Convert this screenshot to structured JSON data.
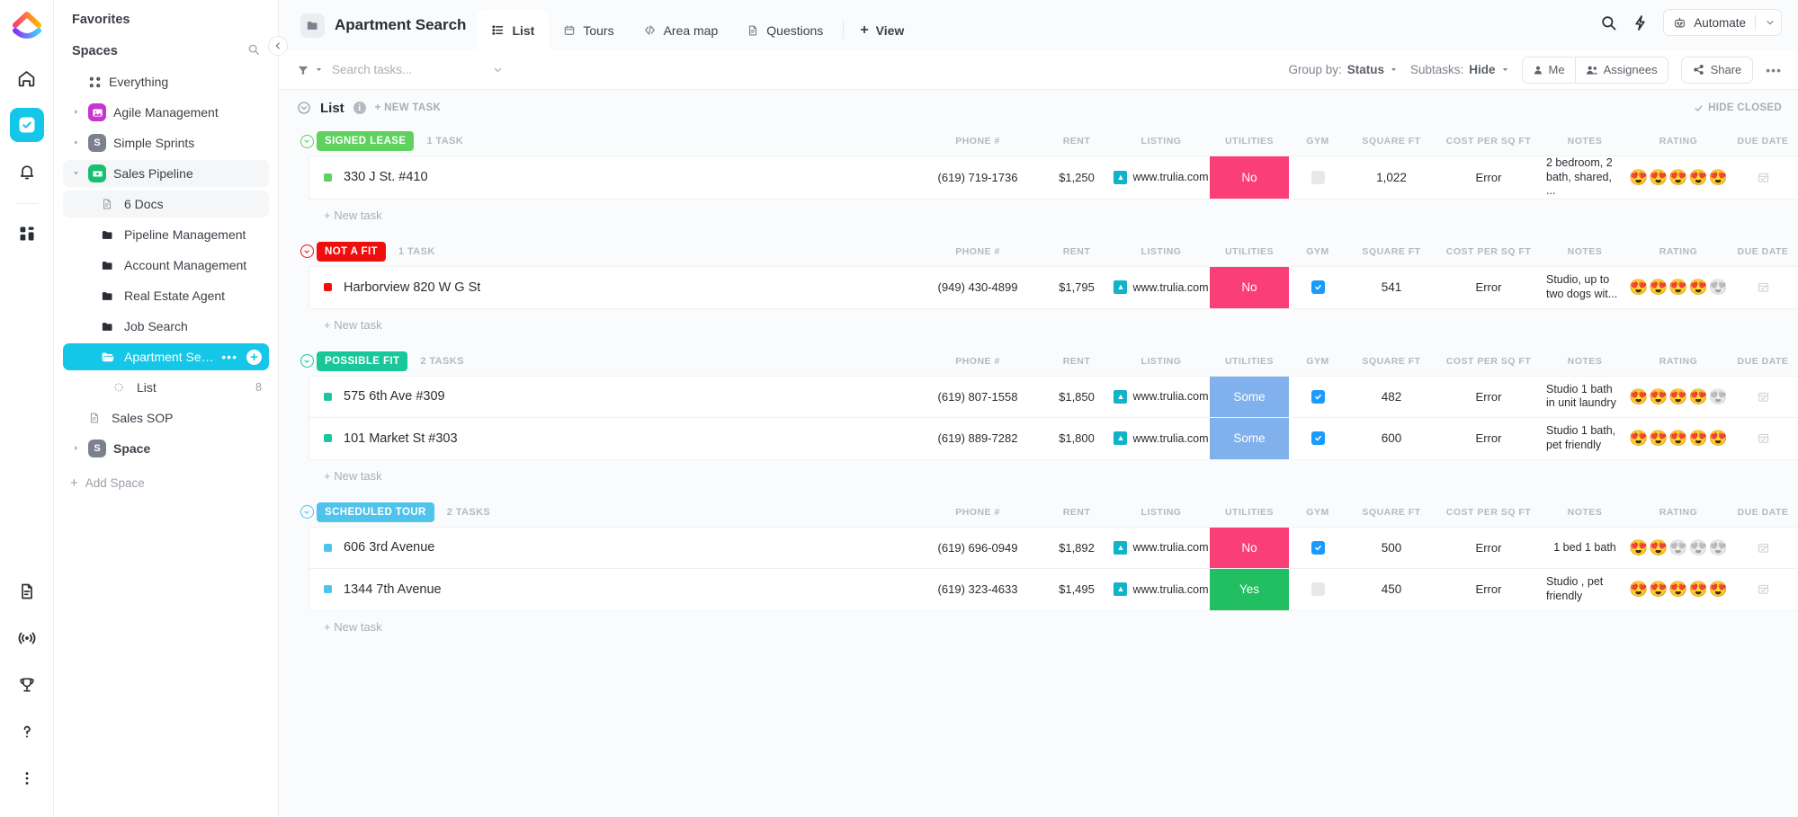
{
  "rail": {
    "logo_icon": "clickup-logo",
    "items": [
      {
        "name": "home-icon",
        "glyph": "home",
        "active": false
      },
      {
        "name": "tasks-icon",
        "glyph": "check",
        "active": true
      },
      {
        "name": "notifications-icon",
        "glyph": "bell",
        "active": false
      },
      {
        "name": "dashboards-icon",
        "glyph": "grid",
        "active": false
      }
    ],
    "bottom_items": [
      {
        "name": "docs-icon",
        "glyph": "doc"
      },
      {
        "name": "pulse-icon",
        "glyph": "pulse"
      },
      {
        "name": "goals-icon",
        "glyph": "trophy"
      },
      {
        "name": "help-icon",
        "glyph": "question"
      },
      {
        "name": "more-icon",
        "glyph": "dots"
      }
    ]
  },
  "sidebar": {
    "favorites_label": "Favorites",
    "spaces_label": "Spaces",
    "spaces_search_icon": "search-icon",
    "everything_label": "Everything",
    "add_space_label": "Add Space",
    "items": [
      {
        "label": "Agile Management",
        "icon_letter": "",
        "icon_color": "#c735d0",
        "icon_glyph": "image",
        "caret": "right",
        "state": "normal",
        "indent": 0
      },
      {
        "label": "Simple Sprints",
        "icon_letter": "S",
        "icon_color": "#7c828d",
        "icon_glyph": "letter",
        "caret": "right",
        "state": "normal",
        "indent": 0
      },
      {
        "label": "Sales Pipeline",
        "icon_letter": "",
        "icon_color": "#18c172",
        "icon_glyph": "money",
        "caret": "down",
        "state": "hover",
        "indent": 0
      },
      {
        "label": "6 Docs",
        "icon_letter": "",
        "icon_color": "",
        "icon_glyph": "doc",
        "caret": "none",
        "state": "hover",
        "indent": 1
      },
      {
        "label": "Pipeline Management",
        "icon_letter": "",
        "icon_color": "",
        "icon_glyph": "folder-solid",
        "caret": "none",
        "state": "normal",
        "indent": 1
      },
      {
        "label": "Account Management",
        "icon_letter": "",
        "icon_color": "",
        "icon_glyph": "folder-solid",
        "caret": "none",
        "state": "normal",
        "indent": 1
      },
      {
        "label": "Real Estate Agent",
        "icon_letter": "",
        "icon_color": "",
        "icon_glyph": "folder-solid",
        "caret": "none",
        "state": "normal",
        "indent": 1
      },
      {
        "label": "Job Search",
        "icon_letter": "",
        "icon_color": "",
        "icon_glyph": "folder-solid",
        "caret": "none",
        "state": "normal",
        "indent": 1
      },
      {
        "label": "Apartment Search",
        "icon_letter": "",
        "icon_color": "",
        "icon_glyph": "folder-open",
        "caret": "none",
        "state": "selected",
        "indent": 1
      },
      {
        "label": "List",
        "icon_letter": "",
        "icon_color": "",
        "icon_glyph": "list-circle",
        "caret": "none",
        "state": "normal",
        "indent": 2,
        "count": "8"
      },
      {
        "label": "Sales SOP",
        "icon_letter": "",
        "icon_color": "",
        "icon_glyph": "doc",
        "caret": "none",
        "state": "normal",
        "indent": 0
      },
      {
        "label": "Space",
        "icon_letter": "S",
        "icon_color": "#7c828d",
        "icon_glyph": "letter",
        "caret": "right",
        "state": "normal",
        "indent": 0
      }
    ],
    "selected_actions": {
      "more_label": "•••",
      "add_label": "+"
    },
    "collapse_icon": "chevron-left-icon"
  },
  "topbar": {
    "folder_icon": "folder-icon",
    "title": "Apartment Search",
    "tabs": [
      {
        "label": "List",
        "icon": "list-icon",
        "active": true
      },
      {
        "label": "Tours",
        "icon": "calendar-icon",
        "active": false
      },
      {
        "label": "Area map",
        "icon": "embed-icon",
        "active": false
      },
      {
        "label": "Questions",
        "icon": "doc-icon",
        "active": false
      }
    ],
    "add_view_label": "View",
    "search_icon": "search-icon",
    "bolt_icon": "bolt-icon",
    "automate_label": "Automate",
    "automate_icon": "robot-icon",
    "automate_caret": "chevron-down-icon"
  },
  "toolbar": {
    "filter_icon": "filter-icon",
    "search_placeholder": "Search tasks...",
    "search_value": "",
    "search_caret_icon": "chevron-down-icon",
    "group_by_label": "Group by:",
    "group_by_value": "Status",
    "subtasks_label": "Subtasks:",
    "subtasks_value": "Hide",
    "me_label": "Me",
    "assignees_label": "Assignees",
    "share_label": "Share",
    "more_label": "•••"
  },
  "list_header": {
    "title": "List",
    "info_icon": "info-icon",
    "new_task_label": "+ NEW TASK",
    "hide_closed_label": "HIDE CLOSED",
    "hide_closed_icon": "check-icon"
  },
  "columns": [
    {
      "key": "phone",
      "label": "PHONE #"
    },
    {
      "key": "rent",
      "label": "RENT"
    },
    {
      "key": "listing",
      "label": "LISTING"
    },
    {
      "key": "utilities",
      "label": "UTILITIES"
    },
    {
      "key": "gym",
      "label": "GYM"
    },
    {
      "key": "sqft",
      "label": "SQUARE FT"
    },
    {
      "key": "cost_sqft",
      "label": "COST PER SQ FT"
    },
    {
      "key": "notes",
      "label": "NOTES"
    },
    {
      "key": "rating",
      "label": "RATING"
    },
    {
      "key": "due",
      "label": "DUE DATE"
    }
  ],
  "new_task_label": "+ New task",
  "groups": [
    {
      "status": "SIGNED LEASE",
      "color": "#5ed15e",
      "task_count": "1 TASK",
      "tasks": [
        {
          "name": "330 J St. #410",
          "dot_color": "#5ed15e",
          "phone": "(619) 719-1736",
          "rent": "$1,250",
          "listing": "www.trulia.com",
          "utilities": "No",
          "utilities_color": "#fa3f77",
          "gym": false,
          "sqft": "1,022",
          "cost_sqft": "Error",
          "notes": "2 bedroom, 2 bath, shared, ...",
          "rating": 5,
          "rating_max": 5
        }
      ]
    },
    {
      "status": "NOT A FIT",
      "color": "#f20d0d",
      "task_count": "1 TASK",
      "tasks": [
        {
          "name": "Harborview 820 W G St",
          "dot_color": "#f20d0d",
          "phone": "(949) 430-4899",
          "rent": "$1,795",
          "listing": "www.trulia.com",
          "utilities": "No",
          "utilities_color": "#fa3f77",
          "gym": true,
          "sqft": "541",
          "cost_sqft": "Error",
          "notes": "Studio, up to two dogs wit...",
          "rating": 4,
          "rating_max": 5
        }
      ]
    },
    {
      "status": "POSSIBLE FIT",
      "color": "#1ac79a",
      "task_count": "2 TASKS",
      "tasks": [
        {
          "name": "575 6th Ave #309",
          "dot_color": "#1ac79a",
          "phone": "(619) 807-1558",
          "rent": "$1,850",
          "listing": "www.trulia.com",
          "utilities": "Some",
          "utilities_color": "#81b1ec",
          "gym": true,
          "sqft": "482",
          "cost_sqft": "Error",
          "notes": "Studio 1 bath in unit laundry",
          "rating": 4,
          "rating_max": 5
        },
        {
          "name": "101 Market St #303",
          "dot_color": "#1ac79a",
          "phone": "(619) 889-7282",
          "rent": "$1,800",
          "listing": "www.trulia.com",
          "utilities": "Some",
          "utilities_color": "#81b1ec",
          "gym": true,
          "sqft": "600",
          "cost_sqft": "Error",
          "notes": "Studio 1 bath, pet friendly",
          "rating": 5,
          "rating_max": 5
        }
      ]
    },
    {
      "status": "SCHEDULED TOUR",
      "color": "#4ec3ec",
      "task_count": "2 TASKS",
      "tasks": [
        {
          "name": "606 3rd Avenue",
          "dot_color": "#4ec3ec",
          "phone": "(619) 696-0949",
          "rent": "$1,892",
          "listing": "www.trulia.com",
          "utilities": "No",
          "utilities_color": "#fa3f77",
          "gym": true,
          "sqft": "500",
          "cost_sqft": "Error",
          "notes": "1 bed 1 bath",
          "rating": 2,
          "rating_max": 5
        },
        {
          "name": "1344 7th Avenue",
          "dot_color": "#4ec3ec",
          "phone": "(619) 323-4633",
          "rent": "$1,495",
          "listing": "www.trulia.com",
          "utilities": "Yes",
          "utilities_color": "#21bf62",
          "gym": false,
          "sqft": "450",
          "cost_sqft": "Error",
          "notes": "Studio\n, pet friendly",
          "rating": 5,
          "rating_max": 5
        }
      ]
    }
  ],
  "colors": {
    "accent": "#14c7e8",
    "sidebar_selected": "#14c7e8"
  }
}
